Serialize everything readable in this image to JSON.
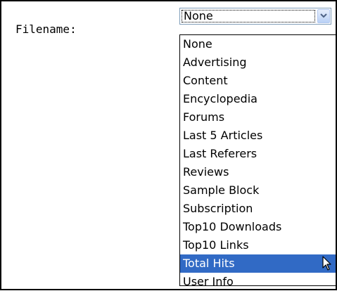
{
  "form": {
    "filename_label": "Filename:"
  },
  "select": {
    "value": "None",
    "options": [
      "None",
      "Advertising",
      "Content",
      "Encyclopedia",
      "Forums",
      "Last 5 Articles",
      "Last Referers",
      "Reviews",
      "Sample Block",
      "Subscription",
      "Top10 Downloads",
      "Top10 Links",
      "Total Hits",
      "User Info"
    ],
    "highlighted_option": "Total Hits"
  },
  "icons": {
    "dropdown": "chevron-down-icon",
    "cursor": "mouse-pointer-icon"
  },
  "colors": {
    "highlight": "#316ac5",
    "select_border": "#7f9db9"
  }
}
